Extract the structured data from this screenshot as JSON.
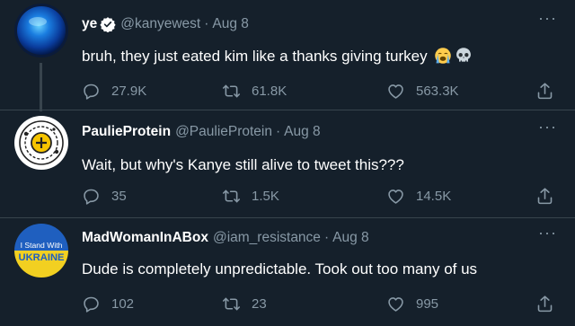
{
  "tweets": [
    {
      "name": "ye",
      "handle": "@kanyewest",
      "date": "Aug 8",
      "verified": true,
      "text": "bruh, they just eated kim like a thanks giving turkey",
      "emojis": [
        "loudly-crying-face-icon",
        "skull-icon"
      ],
      "replies": "27.9K",
      "retweets": "61.8K",
      "likes": "563.3K"
    },
    {
      "name": "PaulieProtein",
      "handle": "@PaulieProtein",
      "date": "Aug 8",
      "text": "Wait, but why's Kanye still alive to tweet this???",
      "replies": "35",
      "retweets": "1.5K",
      "likes": "14.5K"
    },
    {
      "name": "MadWomanInABox",
      "handle": "@iam_resistance",
      "date": "Aug 8",
      "text": "Dude is completely unpredictable. Took out too many of us",
      "avatar_text": [
        "I Stand With",
        "UKRAINE"
      ],
      "replies": "102",
      "retweets": "23",
      "likes": "995"
    }
  ],
  "common": {
    "separator": "·",
    "more": "···"
  },
  "colors": {
    "background": "#15202b",
    "muted": "#8899a6",
    "verified": "#ffffff",
    "divider": "#38444d"
  }
}
